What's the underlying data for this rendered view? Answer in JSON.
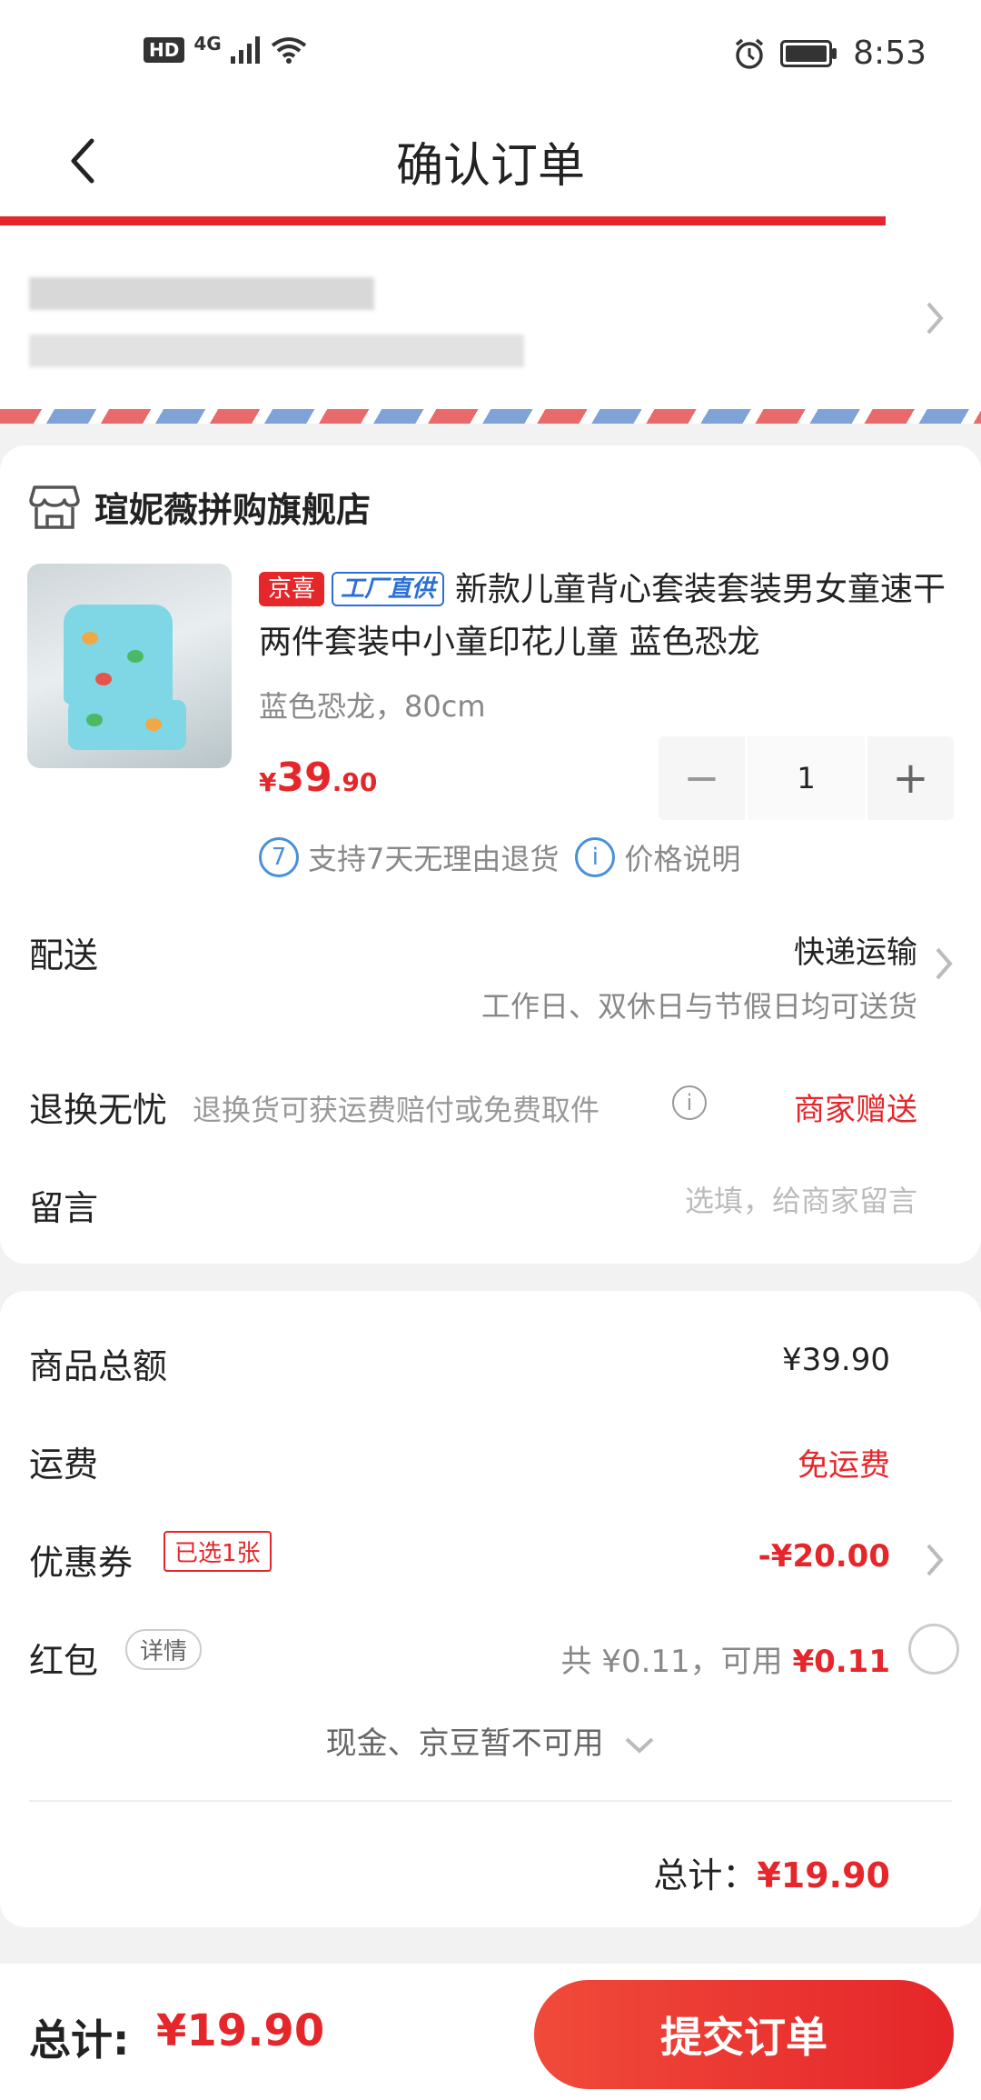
{
  "status_bar": {
    "hd_badge": "HD",
    "network": "4G",
    "time": "8:53"
  },
  "header": {
    "title": "确认订单"
  },
  "shop": {
    "name": "瑄妮薇拼购旗舰店"
  },
  "product": {
    "tag_jingxi": "京喜",
    "tag_factory": "工厂直供",
    "title": "新款儿童背心套装套装男女童速干两件套装中小童印花儿童 蓝色恐龙",
    "spec": "蓝色恐龙，80cm",
    "price_currency": "¥",
    "price_integer": "39",
    "price_decimal": ".90",
    "quantity": "1",
    "minus_label": "−",
    "plus_label": "+"
  },
  "services": {
    "return_icon": "7",
    "return_text": "支持7天无理由退货",
    "price_icon": "i",
    "price_text": "价格说明"
  },
  "delivery": {
    "label": "配送",
    "value": "快递运输",
    "subtext": "工作日、双休日与节假日均可送货"
  },
  "return_worry": {
    "label": "退换无忧",
    "desc": "退换货可获运费赔付或免费取件",
    "info_icon": "i",
    "value": "商家赠送"
  },
  "message": {
    "label": "留言",
    "placeholder": "选填，给商家留言"
  },
  "summary": {
    "subtotal_label": "商品总额",
    "subtotal_value": "¥39.90",
    "shipping_label": "运费",
    "shipping_value": "免运费",
    "coupon_label": "优惠券",
    "coupon_tag": "已选1张",
    "coupon_value": "-¥20.00",
    "redpacket_label": "红包",
    "redpacket_detail": "详情",
    "redpacket_total_prefix": "共 ¥0.11，可用 ",
    "redpacket_usable": "¥0.11",
    "cash_note": "现金、京豆暂不可用",
    "total_prefix": "总计：",
    "total_amount": "¥19.90"
  },
  "bottom_bar": {
    "total_label": "总计:",
    "total_amount": "¥19.90",
    "submit_label": "提交订单"
  },
  "colors": {
    "accent_red": "#e5262a",
    "link_blue": "#2b6fd6"
  }
}
